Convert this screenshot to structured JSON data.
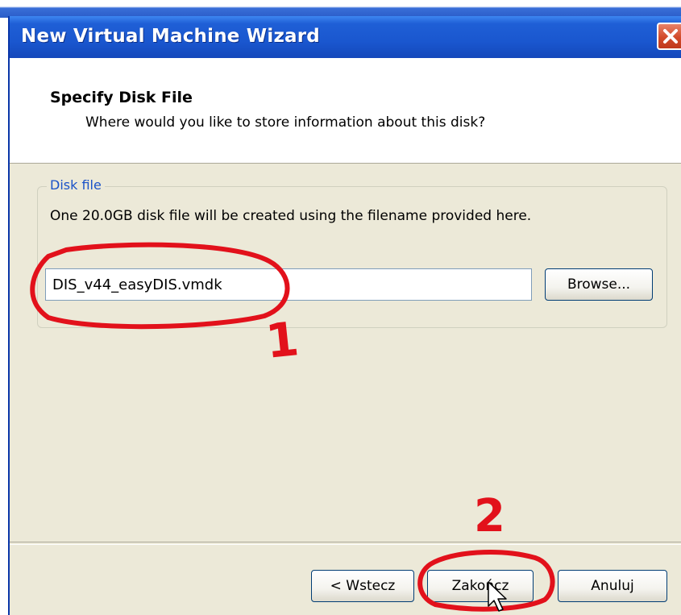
{
  "window": {
    "title": "New Virtual Machine Wizard",
    "close_icon": "close-icon"
  },
  "header": {
    "title": "Specify Disk File",
    "subtitle": "Where would you like to store information about this disk?"
  },
  "disk_group": {
    "legend": "Disk file",
    "description": "One 20.0GB disk file will be created using the filename provided here.",
    "filename_value": "DIS_v44_easyDIS.vmdk",
    "browse_label": "Browse..."
  },
  "footer": {
    "back_label": "< Wstecz",
    "finish_label": "Zakończ",
    "cancel_label": "Anuluj"
  },
  "annotations": {
    "step1": "1",
    "step2": "2",
    "color": "#e2111b"
  }
}
